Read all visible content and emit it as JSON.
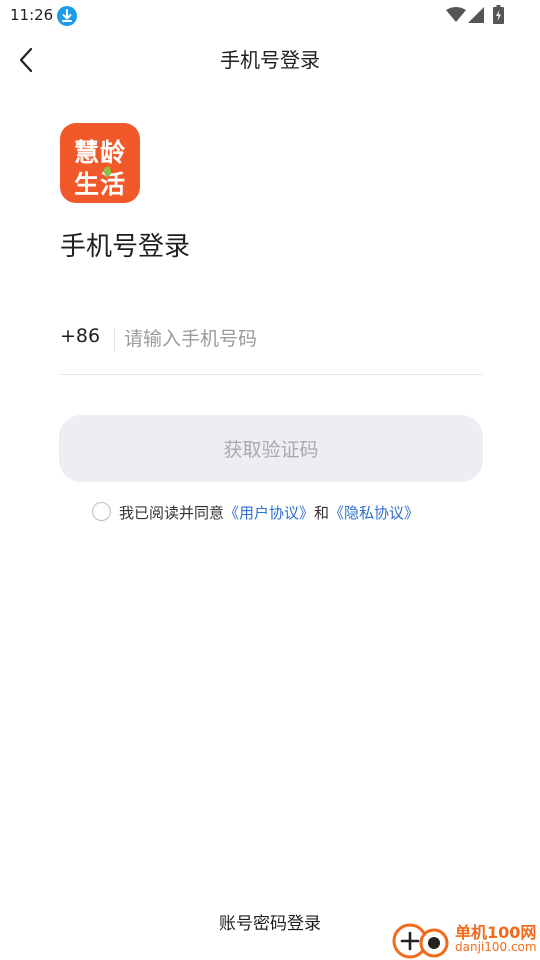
{
  "status_bar": {
    "time": "11:26",
    "icons": [
      "download-icon",
      "wifi-icon",
      "signal-icon",
      "battery-icon"
    ]
  },
  "header": {
    "title": "手机号登录",
    "back_icon": "chevron-left-icon"
  },
  "app_logo": {
    "line1": "慧龄",
    "line2": "生活",
    "color": "#f2592a"
  },
  "form": {
    "heading": "手机号登录",
    "country_code": "+86",
    "phone_placeholder": "请输入手机号码",
    "phone_value": "",
    "get_code_label": "获取验证码",
    "get_code_enabled": false
  },
  "agreement": {
    "checked": false,
    "prefix": "我已阅读并同意",
    "user_agreement": "《用户协议》",
    "and": "和",
    "privacy_agreement": "《隐私协议》",
    "link_color": "#2f6fd0"
  },
  "footer": {
    "alt_login_label": "账号密码登录"
  },
  "watermark": {
    "name": "单机100网",
    "url": "danji100.com"
  }
}
